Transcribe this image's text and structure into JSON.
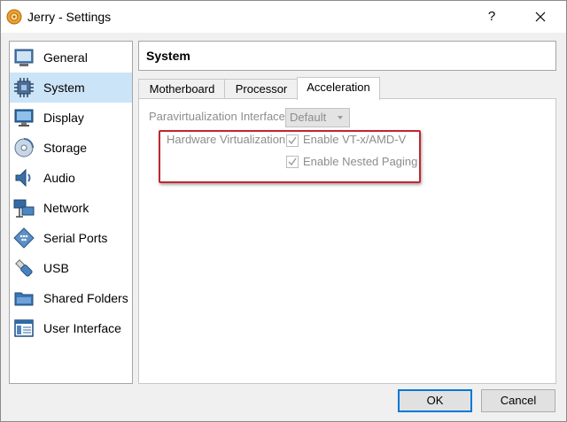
{
  "window": {
    "title": "Jerry - Settings",
    "help_label": "?",
    "icons": {
      "app": "virtualbox-icon",
      "close": "close-icon"
    }
  },
  "sidebar": {
    "items": [
      {
        "label": "General",
        "icon": "general-icon",
        "active": false
      },
      {
        "label": "System",
        "icon": "chip-icon",
        "active": true
      },
      {
        "label": "Display",
        "icon": "monitor-icon",
        "active": false
      },
      {
        "label": "Storage",
        "icon": "storage-icon",
        "active": false
      },
      {
        "label": "Audio",
        "icon": "speaker-icon",
        "active": false
      },
      {
        "label": "Network",
        "icon": "network-icon",
        "active": false
      },
      {
        "label": "Serial Ports",
        "icon": "serial-port-icon",
        "active": false
      },
      {
        "label": "USB",
        "icon": "usb-icon",
        "active": false
      },
      {
        "label": "Shared Folders",
        "icon": "folder-icon",
        "active": false
      },
      {
        "label": "User Interface",
        "icon": "window-icon",
        "active": false
      }
    ]
  },
  "page": {
    "title": "System",
    "tabs": [
      {
        "label": "Motherboard",
        "active": false
      },
      {
        "label": "Processor",
        "active": false
      },
      {
        "label": "Acceleration",
        "active": true
      }
    ]
  },
  "acceleration": {
    "paravirt_label": "Paravirtualization Interface:",
    "paravirt_value": "Default",
    "hw_virt_label": "Hardware Virtualization:",
    "enable_vtx_label": "Enable VT-x/AMD-V",
    "enable_vtx_checked": true,
    "enable_nested_label": "Enable Nested Paging",
    "enable_nested_checked": true
  },
  "buttons": {
    "ok": "OK",
    "cancel": "Cancel"
  },
  "colors": {
    "selection": "#cce4f7",
    "highlight_border": "#c0272d",
    "default_button_border": "#0078d7"
  }
}
